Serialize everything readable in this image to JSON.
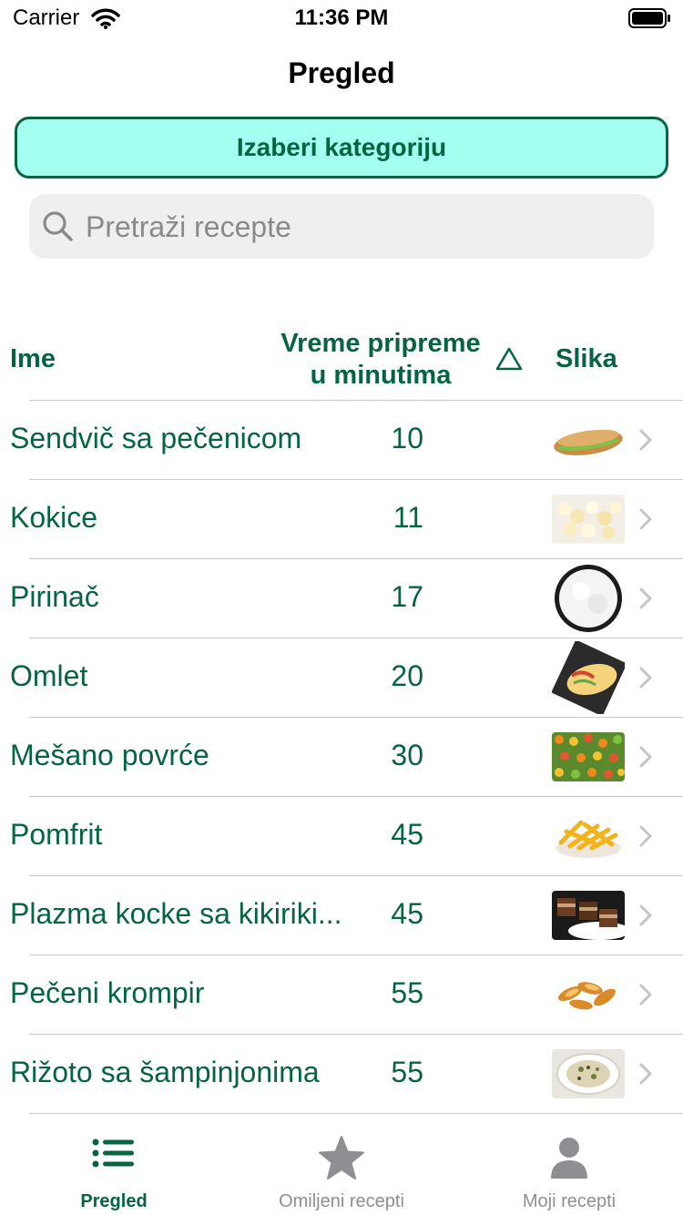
{
  "status_bar": {
    "carrier": "Carrier",
    "time": "11:36 PM"
  },
  "nav": {
    "title": "Pregled"
  },
  "category_button": {
    "label": "Izaberi kategoriju"
  },
  "search": {
    "placeholder": "Pretraži recepte",
    "icon": "search-icon"
  },
  "table_header": {
    "name": "Ime",
    "time_line1": "Vreme pripreme",
    "time_line2": "u minutima",
    "sort_symbol": "△",
    "image": "Slika"
  },
  "recipes": [
    {
      "name": "Sendvič sa pečenicom",
      "time": "10",
      "image": "sandwich"
    },
    {
      "name": "Kokice",
      "time": "11",
      "image": "popcorn"
    },
    {
      "name": "Pirinač",
      "time": "17",
      "image": "rice"
    },
    {
      "name": "Omlet",
      "time": "20",
      "image": "omelette"
    },
    {
      "name": "Mešano povrće",
      "time": "30",
      "image": "mixed-vegetables"
    },
    {
      "name": "Pomfrit",
      "time": "45",
      "image": "fries"
    },
    {
      "name": "Plazma kocke sa kikiriki...",
      "time": "45",
      "image": "cake-cubes"
    },
    {
      "name": "Pečeni krompir",
      "time": "55",
      "image": "roasted-potatoes"
    },
    {
      "name": "Rižoto sa šampinjonima",
      "time": "55",
      "image": "risotto"
    }
  ],
  "tabs": [
    {
      "label": "Pregled",
      "icon": "list-icon",
      "active": true
    },
    {
      "label": "Omiljeni recepti",
      "icon": "star-icon",
      "active": false
    },
    {
      "label": "Moji recepti",
      "icon": "person-icon",
      "active": false
    }
  ],
  "colors": {
    "accent": "#066440",
    "button_bg": "#a5fff0",
    "inactive": "#8e8e93"
  }
}
